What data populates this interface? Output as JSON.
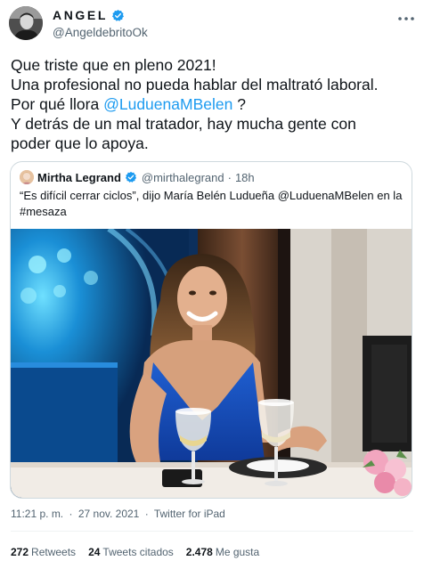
{
  "author": {
    "name": "ANGEL",
    "handle": "@AngeldebritoOk"
  },
  "tweet": {
    "line1": "Que triste que en pleno 2021!",
    "line2": "Una profesional no pueda hablar del maltrató laboral.",
    "line3_pre": "Por qué llora ",
    "line3_mention": "@LuduenaMBelen",
    "line3_post": " ?",
    "line4": "Y detrás de un mal tratador, hay mucha gente con",
    "line5": "poder que lo apoya."
  },
  "quote": {
    "name": "Mirtha Legrand",
    "handle": "@mirthalegrand",
    "dot": "·",
    "time": "18h",
    "line1": "“Es difícil cerrar ciclos”, dijo María Belén Ludueña @LuduenaMBelen en la",
    "line2": "#mesaza"
  },
  "meta": {
    "time": "11:21 p. m.",
    "dot1": "·",
    "date": "27 nov. 2021",
    "dot2": "·",
    "source": "Twitter for iPad"
  },
  "stats": {
    "retweets_count": "272",
    "retweets_label": "Retweets",
    "quotes_count": "24",
    "quotes_label": "Tweets citados",
    "likes_count": "2.478",
    "likes_label": "Me gusta"
  },
  "colors": {
    "accent": "#1d9bf0",
    "text": "#0f1419",
    "secondary": "#536471",
    "border": "#cfd9de",
    "verified": "#1d9bf0"
  },
  "icons": {
    "verified": "verified-badge-icon",
    "more": "more-options-icon"
  }
}
